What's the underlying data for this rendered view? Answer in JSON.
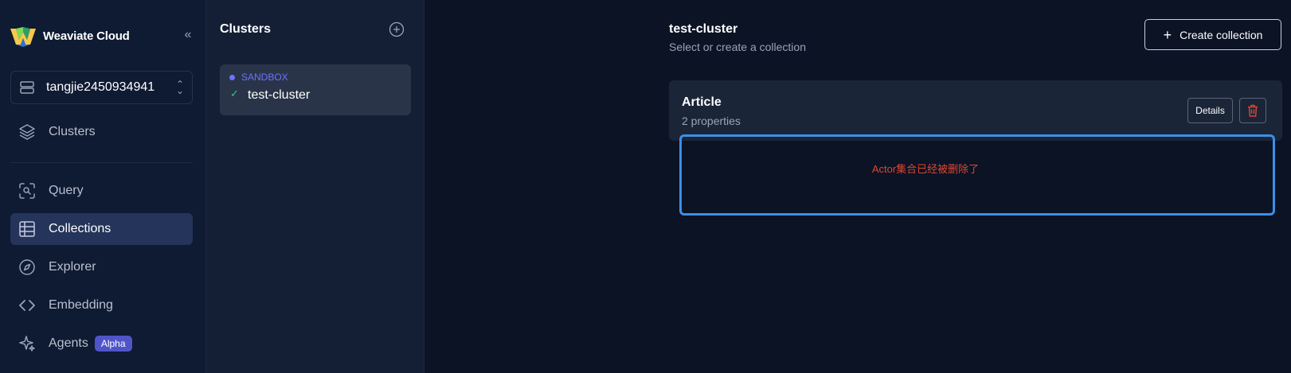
{
  "app": {
    "logo_text": "Weaviate Cloud",
    "org_name": "tangjie2450934941"
  },
  "nav": {
    "items": [
      {
        "label": "Clusters",
        "icon": "layers-icon"
      },
      {
        "label": "Query",
        "icon": "query-scan-icon"
      },
      {
        "label": "Collections",
        "icon": "table-icon",
        "active": true
      },
      {
        "label": "Explorer",
        "icon": "compass-icon"
      },
      {
        "label": "Embedding",
        "icon": "code-brackets-icon"
      },
      {
        "label": "Agents",
        "icon": "sparkles-icon",
        "badge": "Alpha"
      }
    ]
  },
  "cluster_panel": {
    "title": "Clusters",
    "cluster": {
      "tier": "SANDBOX",
      "name": "test-cluster"
    }
  },
  "main": {
    "title": "test-cluster",
    "subtitle": "Select or create a collection",
    "create_button": "Create collection",
    "collection": {
      "name": "Article",
      "properties": "2 properties",
      "details_button": "Details"
    },
    "notice": "Actor集合已经被删除了"
  },
  "colors": {
    "accent": "#6d72ff",
    "active_nav": "#25345a",
    "danger": "#e0452f",
    "highlight_border": "#3d8fe6",
    "success": "#3fbf7f"
  }
}
